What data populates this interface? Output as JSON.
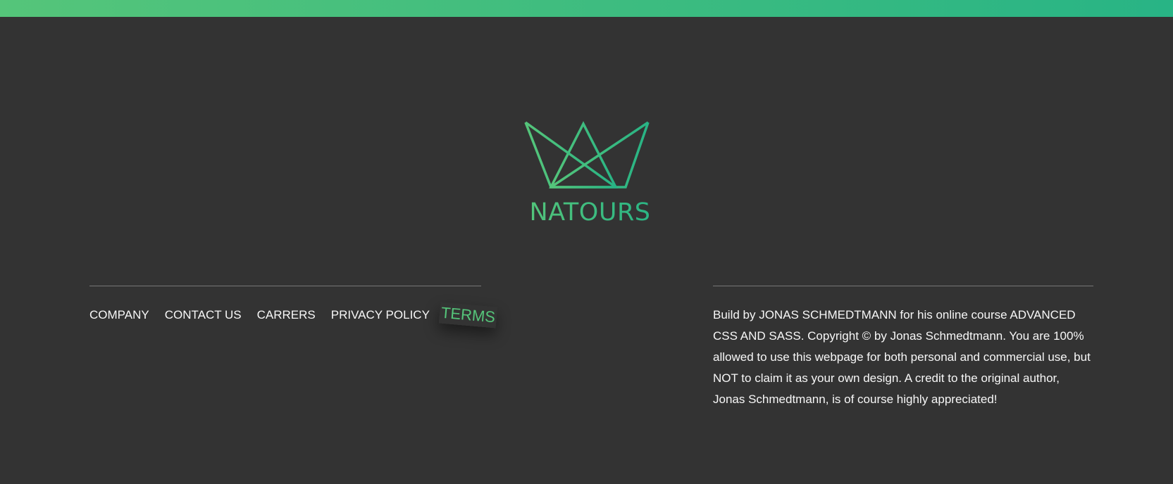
{
  "brand": {
    "name": "NATOURS",
    "logo_icon": "crown-triangles-icon",
    "gradient_start": "#55c57a",
    "gradient_end": "#28b485"
  },
  "colors": {
    "background": "#333333",
    "text": "#f7f7f7",
    "divider": "#777777"
  },
  "nav": {
    "items": [
      {
        "label": "COMPANY"
      },
      {
        "label": "CONTACT US"
      },
      {
        "label": "CARRERS"
      },
      {
        "label": "PRIVACY POLICY"
      },
      {
        "label": "TERMS",
        "state": "hover"
      }
    ]
  },
  "copyright": {
    "text": "Build by JONAS SCHMEDTMANN for his online course ADVANCED CSS AND SASS. Copyright © by Jonas Schmedtmann. You are 100% allowed to use this webpage for both personal and commercial use, but NOT to claim it as your own design. A credit to the original author, Jonas Schmedtmann, is of course highly appreciated!"
  }
}
